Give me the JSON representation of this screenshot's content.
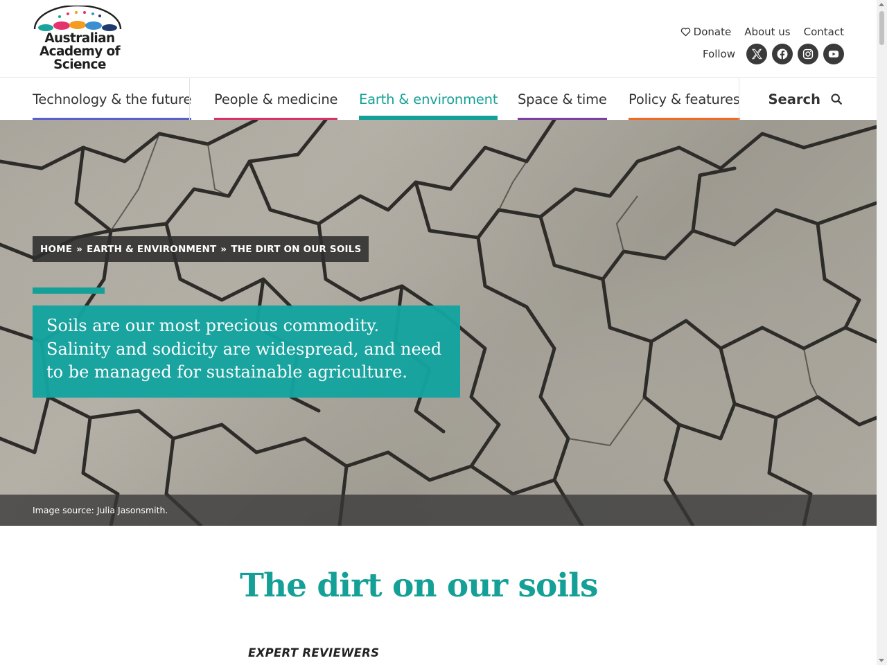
{
  "logo": {
    "lines": [
      "Australian",
      "Academy of",
      "Science"
    ],
    "colors": [
      "#1aa39a",
      "#e5336d",
      "#f39c1f",
      "#3b8fd1",
      "#1f3a6e"
    ]
  },
  "top_links": {
    "donate": "Donate",
    "about": "About us",
    "contact": "Contact"
  },
  "follow": {
    "label": "Follow",
    "icons": [
      "x-icon",
      "facebook-icon",
      "instagram-icon",
      "youtube-icon"
    ]
  },
  "nav": {
    "items": [
      {
        "label": "Technology & the future",
        "color": "#5b5fc7"
      },
      {
        "label": "People & medicine",
        "color": "#d6336c"
      },
      {
        "label": "Earth & environment",
        "color": "#14a097"
      },
      {
        "label": "Space & time",
        "color": "#7b3fa0"
      },
      {
        "label": "Policy & features",
        "color": "#f06a22"
      }
    ],
    "active_index": 2,
    "search_label": "Search"
  },
  "breadcrumb": {
    "home": "HOME",
    "section": "EARTH & ENVIRONMENT",
    "current": "THE DIRT ON OUR SOILS",
    "separator": "»"
  },
  "hero": {
    "callout": "Soils are our most precious commodity. Salinity and sodicity are widespread, and need to be managed for sustainable agriculture.",
    "caption": "Image source: Julia Jasonsmith."
  },
  "article": {
    "title": "The dirt on our soils",
    "reviewers_heading": "EXPERT REVIEWERS"
  },
  "colors": {
    "accent": "#14a097",
    "callout_bg": "#14a4a0"
  }
}
